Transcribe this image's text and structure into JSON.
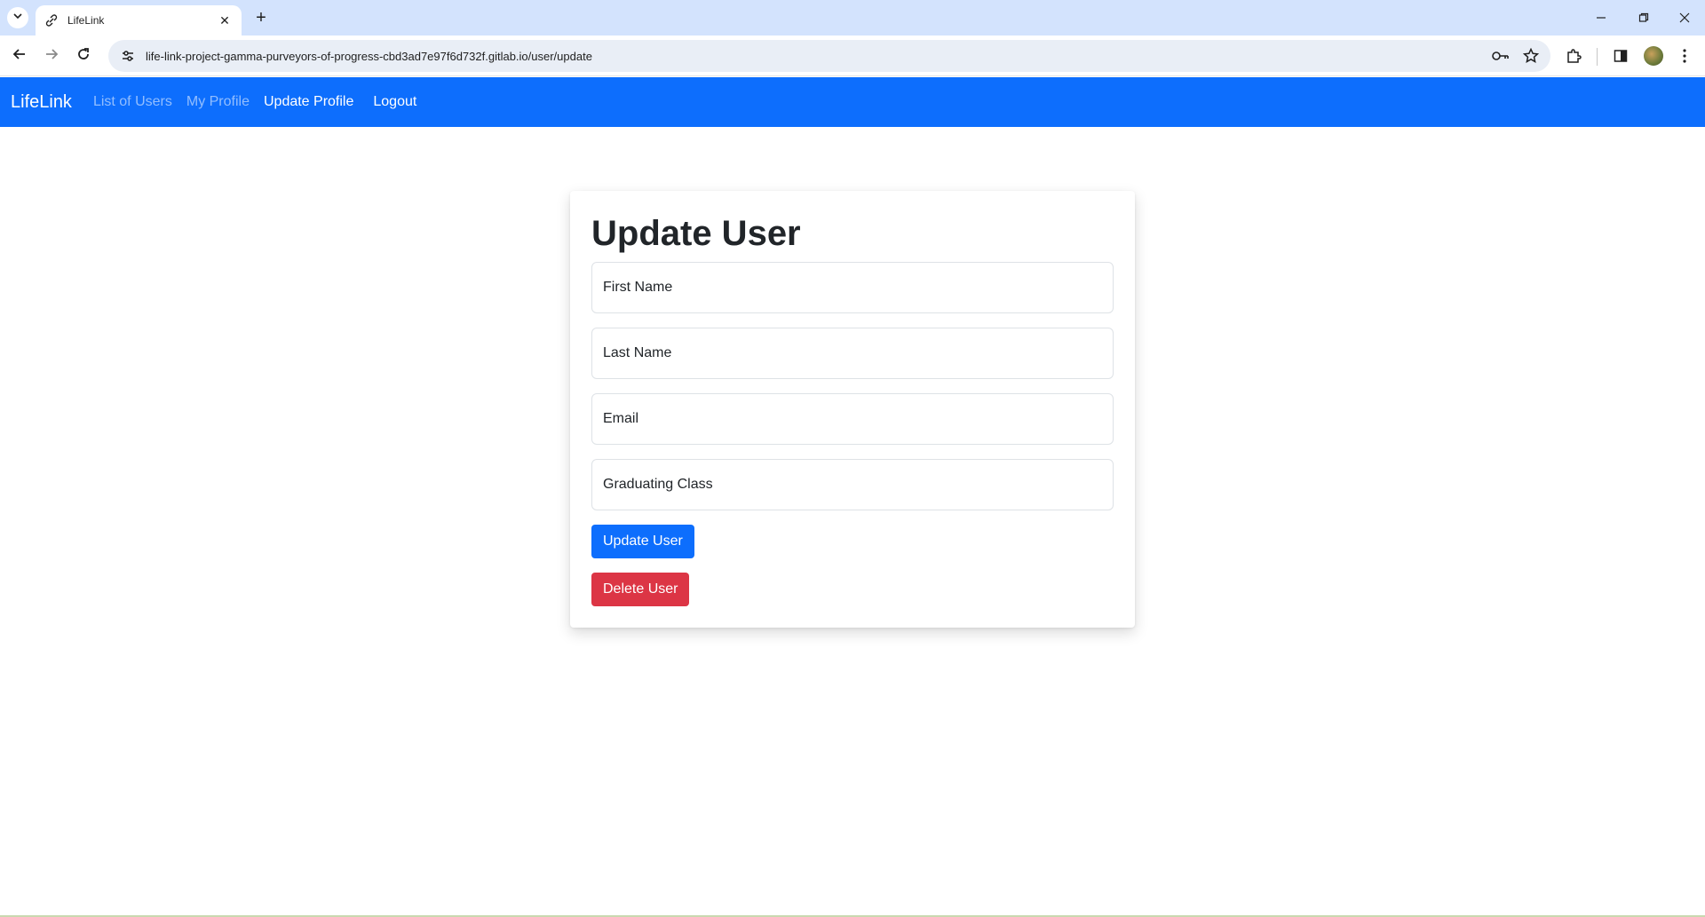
{
  "browser": {
    "tab_title": "LifeLink",
    "tab_close": "✕",
    "new_tab": "+",
    "url": "life-link-project-gamma-purveyors-of-progress-cbd3ad7e97f6d732f.gitlab.io/user/update",
    "window_controls": {
      "minimize": "—",
      "restore": "❐",
      "close": "✕"
    }
  },
  "navbar": {
    "brand": "LifeLink",
    "links": [
      {
        "label": "List of Users",
        "active": false
      },
      {
        "label": "My Profile",
        "active": false
      },
      {
        "label": "Update Profile",
        "active": true
      },
      {
        "label": "Logout",
        "active": true
      }
    ]
  },
  "form": {
    "title": "Update User",
    "fields": {
      "first_name": {
        "placeholder": "First Name",
        "value": ""
      },
      "last_name": {
        "placeholder": "Last Name",
        "value": ""
      },
      "email": {
        "placeholder": "Email",
        "value": ""
      },
      "graduating_class": {
        "placeholder": "Graduating Class",
        "value": ""
      }
    },
    "update_button": "Update User",
    "delete_button": "Delete User"
  },
  "colors": {
    "navbar_bg": "#0d6efd",
    "primary": "#0d6efd",
    "danger": "#dc3545",
    "tabstrip_bg": "#d3e3fd"
  }
}
